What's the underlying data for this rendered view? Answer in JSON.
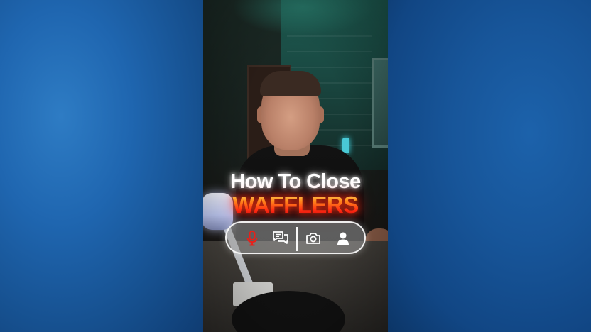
{
  "caption": {
    "line1": "How To Close",
    "line2": "WAFFLERS"
  },
  "toolbar": {
    "buttons": [
      {
        "icon": "microphone-icon",
        "active": true,
        "color": "#e8201a"
      },
      {
        "icon": "chat-bubbles-icon",
        "active": false,
        "color": "#ffffff"
      },
      {
        "icon": "camera-icon",
        "active": false,
        "color": "#ffffff"
      },
      {
        "icon": "user-icon",
        "active": false,
        "color": "#ffffff"
      }
    ]
  },
  "colors": {
    "background_blur": "#1d5fa5",
    "caption_primary": "#ffffff",
    "caption_accent": "#ff2a12"
  }
}
